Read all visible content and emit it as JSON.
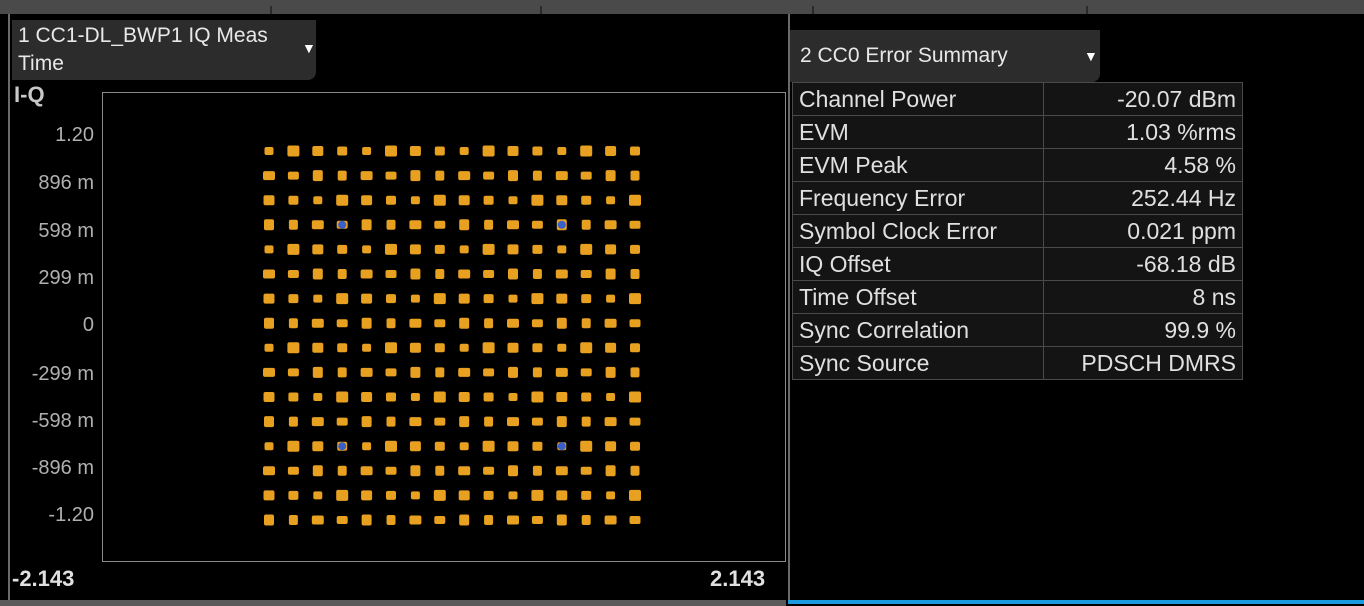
{
  "window1": {
    "title_line1": "1 CC1-DL_BWP1  IQ Meas",
    "title_line2": "Time",
    "trace_label": "I-Q",
    "y_ticks": [
      "1.20",
      "896 m",
      "598 m",
      "299 m",
      "0",
      "-299 m",
      "-598 m",
      "-896 m",
      "-1.20"
    ],
    "x_min_label": "-2.143",
    "x_max_label": "2.143",
    "dropdown_icon": "triangle-down",
    "constellation": {
      "type": "scatter",
      "grid_columns": 16,
      "grid_rows": 16,
      "point_color": "#e8a020",
      "highlight_color": "#3a5fc8",
      "highlighted_points": [
        [
          3,
          3
        ],
        [
          12,
          3
        ],
        [
          3,
          12
        ],
        [
          12,
          12
        ]
      ]
    }
  },
  "window2": {
    "title": "2 CC0 Error Summary",
    "dropdown_icon": "triangle-down",
    "rows": [
      {
        "label": "Channel Power",
        "value": "-20.07 dBm"
      },
      {
        "label": "EVM",
        "value": "1.03 %rms"
      },
      {
        "label": "EVM Peak",
        "value": "4.58 %"
      },
      {
        "label": "Frequency Error",
        "value": "252.44 Hz"
      },
      {
        "label": "Symbol Clock Error",
        "value": "0.021 ppm"
      },
      {
        "label": "IQ Offset",
        "value": "-68.18 dB"
      },
      {
        "label": "Time Offset",
        "value": "8 ns"
      },
      {
        "label": "Sync Correlation",
        "value": "99.9 %"
      },
      {
        "label": "Sync Source",
        "value": "PDSCH DMRS"
      }
    ]
  },
  "colors": {
    "background": "#000000",
    "active_window_indicator": "#1a9be0"
  }
}
